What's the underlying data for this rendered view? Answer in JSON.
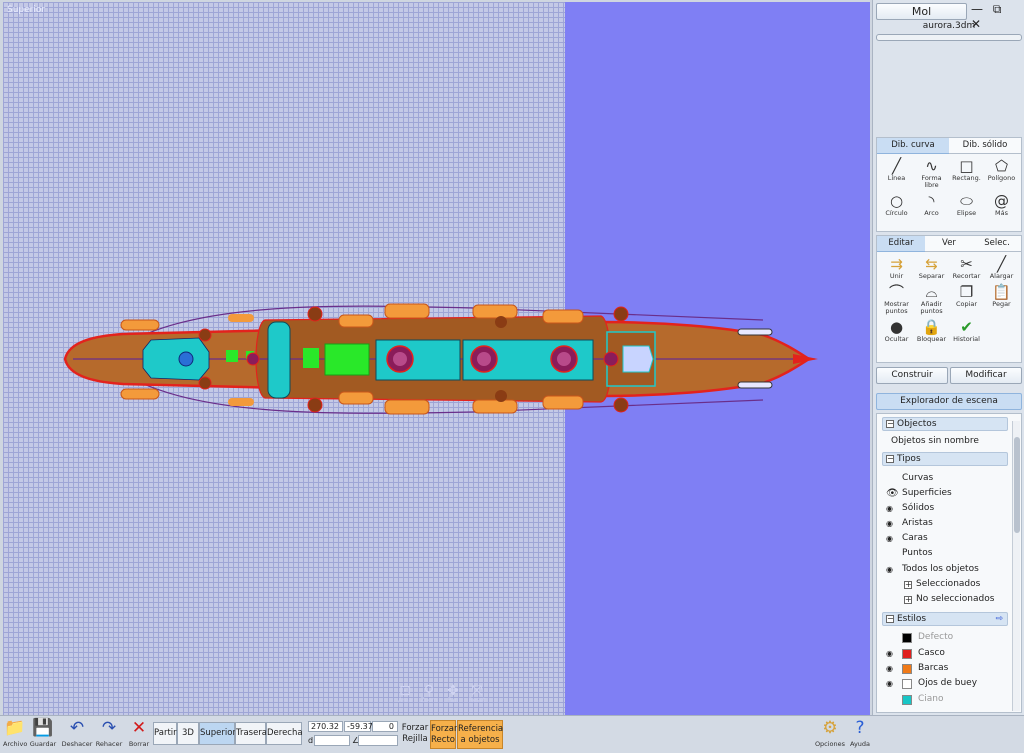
{
  "viewport": {
    "title": "Superior"
  },
  "nav": {
    "items": [
      "Area",
      "Zoom",
      "Pan",
      "Reset"
    ]
  },
  "panel": {
    "mode_button": "Mol",
    "window_icons": "— ⧉ ✕",
    "filename": "aurora.3dm",
    "curve_tabs": [
      "Dib. curva",
      "Dib. sólido"
    ],
    "curve_tools": [
      "Línea",
      "Forma libre",
      "Rectang.",
      "Polígono",
      "Círculo",
      "Arco",
      "Elipse",
      "Más"
    ],
    "edit_tabs": [
      "Editar",
      "Ver",
      "Selec."
    ],
    "edit_tools": [
      "Unir",
      "Separar",
      "Recortar",
      "Alargar",
      "Mostrar puntos",
      "Añadir puntos",
      "Copiar",
      "Pegar",
      "Ocultar",
      "Bloquear",
      "Historial"
    ],
    "build_label": "Construir",
    "modify_label": "Modificar",
    "explorer_label": "Explorador de escena",
    "objects_section": "Objectos",
    "objects_unnamed": "Objetos sin nombre",
    "types_section": "Tipos",
    "types": [
      "Curvas",
      "Superficies",
      "Sólidos",
      "Aristas",
      "Caras",
      "Puntos",
      "Todos los objetos"
    ],
    "sub_types": [
      "Seleccionados",
      "No seleccionados"
    ],
    "styles_section": "Estilos",
    "styles": [
      {
        "name": "Defecto",
        "color": "#000000"
      },
      {
        "name": "Casco",
        "color": "#e0201e"
      },
      {
        "name": "Barcas",
        "color": "#f07a18"
      },
      {
        "name": "Ojos de buey",
        "color": "#ffffff"
      },
      {
        "name": "Ciano",
        "color": "#18c6c6"
      }
    ]
  },
  "toolbar": {
    "file_buttons": [
      "Archivo",
      "Guardar",
      "Deshacer",
      "Rehacer",
      "Borrar"
    ],
    "views": [
      "Partir",
      "3D",
      "Superior",
      "Trasera",
      "Derecha"
    ],
    "active_view": "Superior",
    "coords": {
      "x": "270.32",
      "y": "-59.37",
      "z": "0",
      "d_label": "d",
      "angle_label": "∠"
    },
    "snap_grid": "Forzar Rejilla",
    "snap_ortho": "Forzar Recto",
    "object_ref": "Referencia a objetos",
    "options": "Opciones",
    "help": "Ayuda"
  },
  "colors": {
    "viewport_bg": "#7f7ff4",
    "hull": "#b66a2c",
    "hull_outline": "#e3221d",
    "boats": "#f39a3b",
    "cyan": "#1ec9c9",
    "funnel": "#8a1c5a",
    "deck_green": "#29e829"
  }
}
